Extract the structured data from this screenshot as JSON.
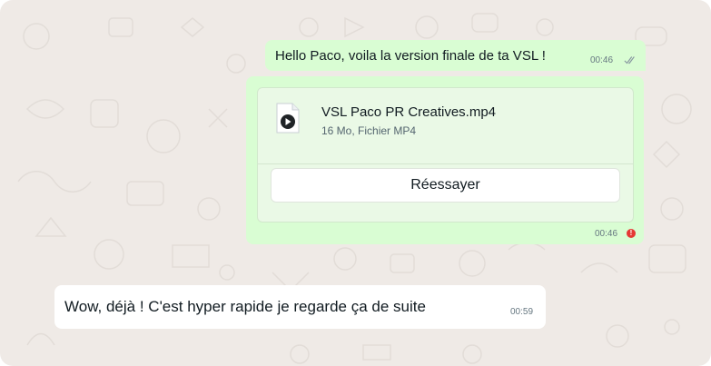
{
  "messages": {
    "outgoing_text": {
      "text": "Hello Paco, voila la version finale de ta VSL !",
      "time": "00:46",
      "status_icon": "double-check-icon"
    },
    "outgoing_file": {
      "file_name": "VSL Paco PR Creatives.mp4",
      "file_meta": "16 Mo, Fichier MP4",
      "file_icon": "video-file-icon",
      "retry_label": "Réessayer",
      "time": "00:46",
      "status_icon": "error-icon",
      "status_glyph": "!"
    },
    "incoming_text": {
      "text": "Wow, déjà ! C'est hyper rapide je regarde ça de suite",
      "time": "00:59"
    }
  },
  "colors": {
    "chat_background": "#efeae6",
    "outgoing_bubble": "#d9fdd3",
    "incoming_bubble": "#ffffff",
    "error": "#e53935"
  }
}
